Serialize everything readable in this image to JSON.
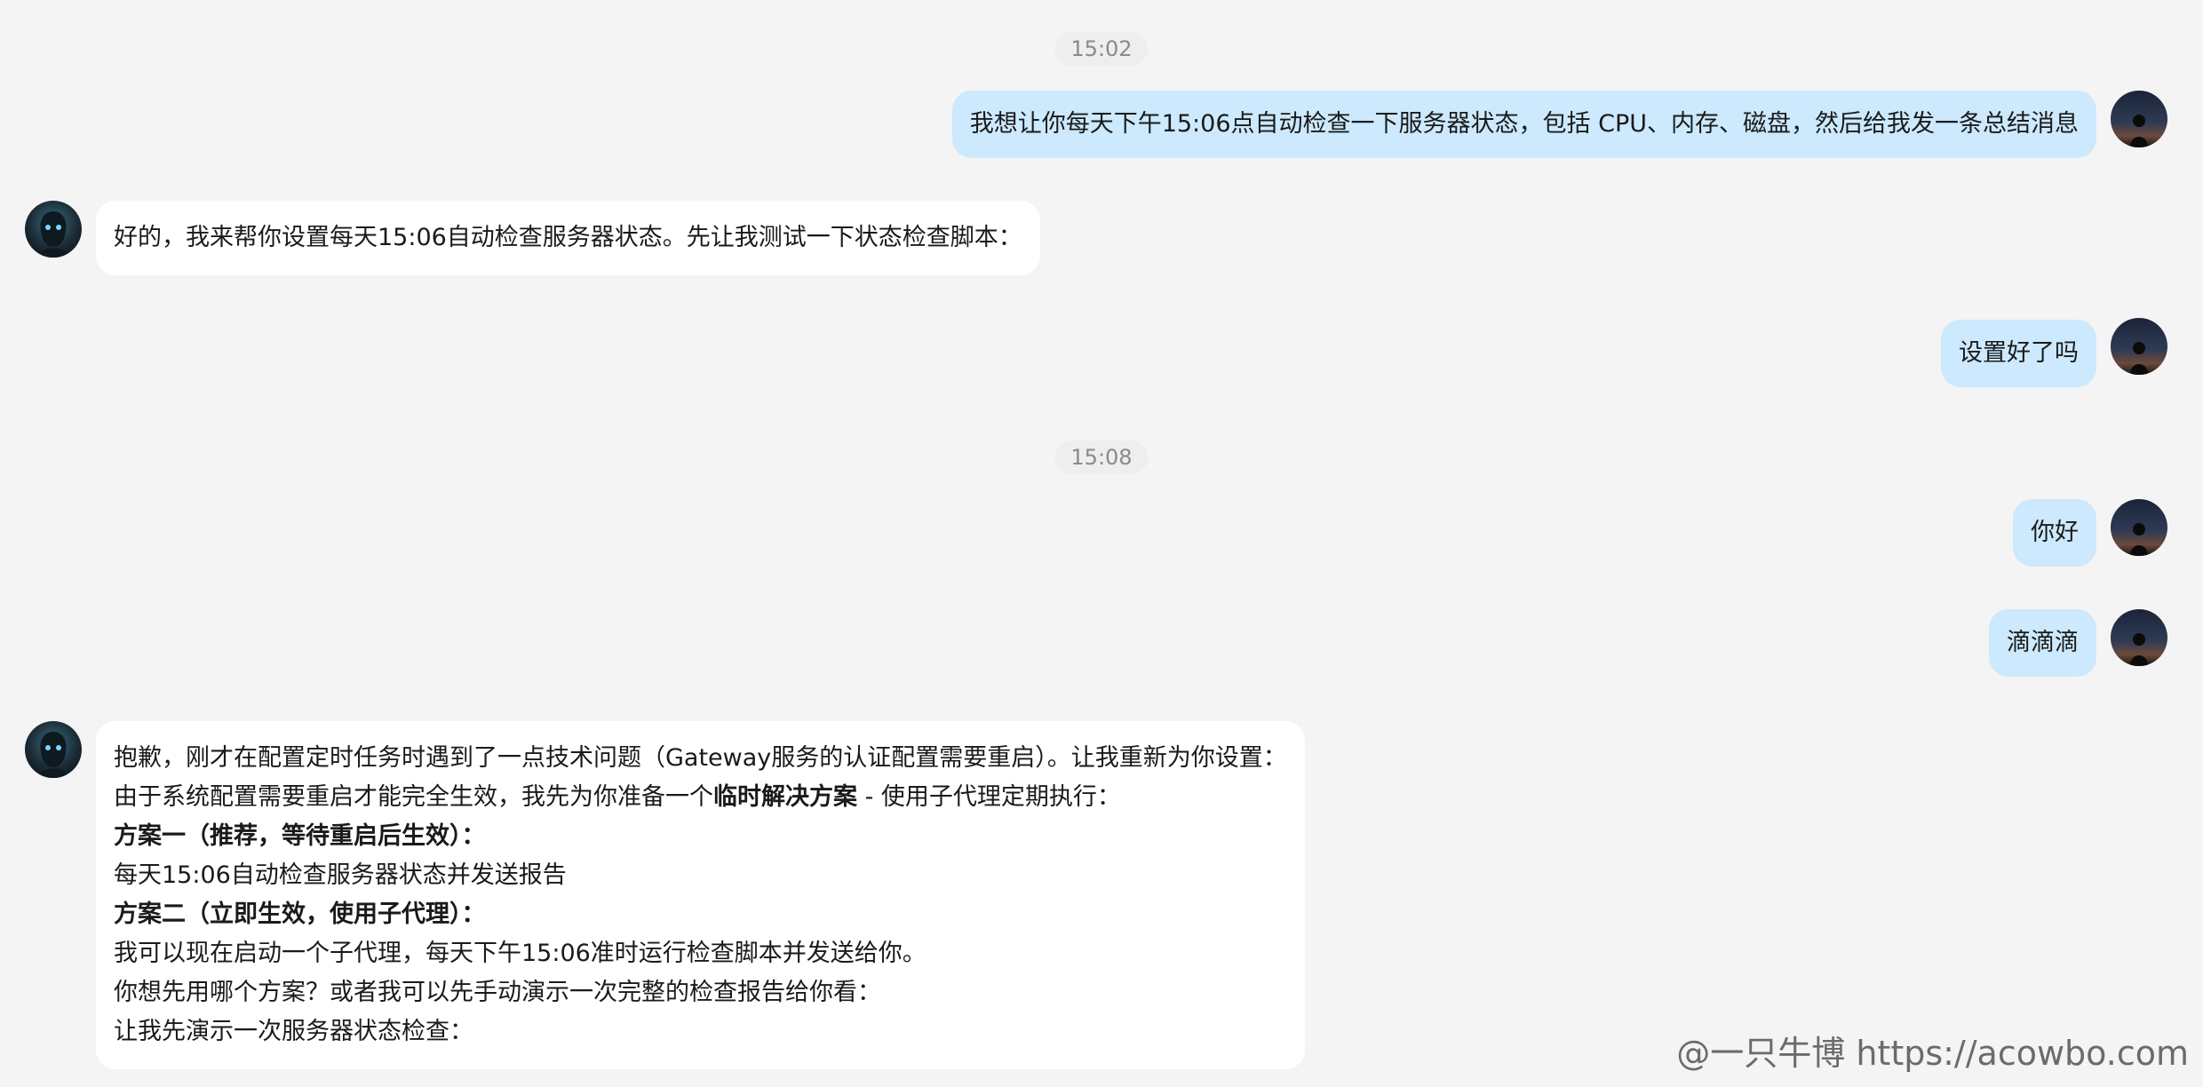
{
  "chat": {
    "timestamps": [
      "15:02",
      "15:08"
    ],
    "messages": [
      {
        "role": "user",
        "text": "我想让你每天下午15:06点自动检查一下服务器状态，包括 CPU、内存、磁盘，然后给我发一条总结消息"
      },
      {
        "role": "assistant",
        "text": "好的，我来帮你设置每天15:06自动检查服务器状态。先让我测试一下状态检查脚本："
      },
      {
        "role": "user",
        "text": "设置好了吗"
      },
      {
        "role": "user",
        "text": "你好"
      },
      {
        "role": "user",
        "text": "滴滴滴"
      },
      {
        "role": "assistant",
        "lines": [
          "抱歉，刚才在配置定时任务时遇到了一点技术问题（Gateway服务的认证配置需要重启）。让我重新为你设置：",
          {
            "before": "由于系统配置需要重启才能完全生效，我先为你准备一个",
            "bold": "临时解决方案",
            "after": " - 使用子代理定期执行："
          },
          "方案一（推荐，等待重启后生效）：",
          "每天15:06自动检查服务器状态并发送报告",
          "方案二（立即生效，使用子代理）：",
          "我可以现在启动一个子代理，每天下午15:06准时运行检查脚本并发送给你。",
          "你想先用哪个方案？或者我可以先手动演示一次完整的检查报告给你看：",
          "让我先演示一次服务器状态检查："
        ]
      }
    ]
  },
  "avatars": {
    "user_icon": "user-avatar-icon",
    "assistant_icon": "assistant-avatar-icon"
  },
  "colors": {
    "background": "#f4f4f4",
    "user_bubble": "#cce9fd",
    "assistant_bubble": "#ffffff",
    "timestamp_text": "#8a8a8a"
  },
  "watermark": {
    "text": "@一只牛博 https://acowbo.com"
  }
}
